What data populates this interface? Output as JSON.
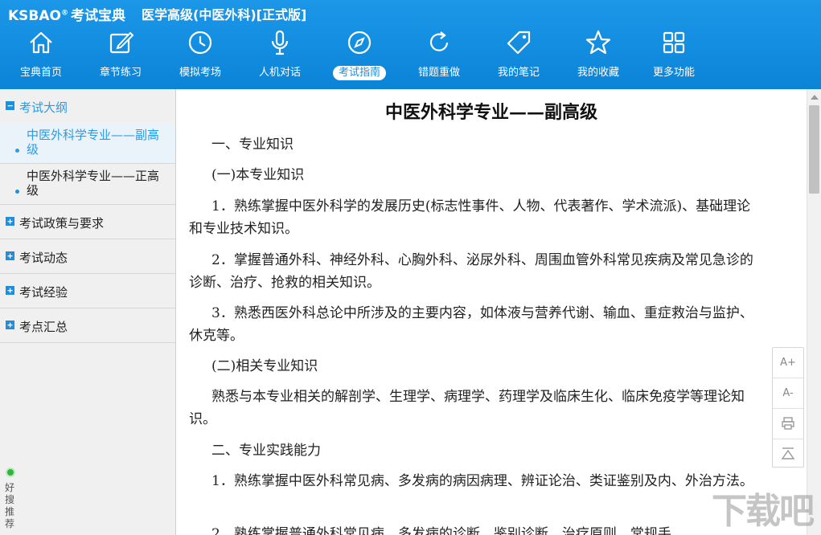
{
  "app": {
    "logo_text": "KSBAO",
    "logo_cn": "考试宝典",
    "title": "医学高级(中医外科)[正式版]"
  },
  "nav": [
    {
      "label": "宝典首页",
      "icon": "home-icon"
    },
    {
      "label": "章节练习",
      "icon": "edit-icon"
    },
    {
      "label": "模拟考场",
      "icon": "clock-icon"
    },
    {
      "label": "人机对话",
      "icon": "microphone-icon"
    },
    {
      "label": "考试指南",
      "icon": "compass-icon",
      "active": true
    },
    {
      "label": "错题重做",
      "icon": "refresh-icon"
    },
    {
      "label": "我的笔记",
      "icon": "tag-icon"
    },
    {
      "label": "我的收藏",
      "icon": "star-icon"
    },
    {
      "label": "更多功能",
      "icon": "grid-icon"
    }
  ],
  "sidebar": {
    "sections": [
      {
        "label": "考试大纲",
        "expanded": true,
        "items": [
          "中医外科学专业——副高级",
          "中医外科学专业——正高级"
        ]
      },
      {
        "label": "考试政策与要求"
      },
      {
        "label": "考试动态"
      },
      {
        "label": "考试经验"
      },
      {
        "label": "考点汇总"
      }
    ],
    "recommend": "好搜推荐"
  },
  "doc": {
    "title": "中医外科学专业——副高级",
    "paragraphs": [
      "一、专业知识",
      "(一)本专业知识",
      "1．熟练掌握中医外科学的发展历史(标志性事件、人物、代表著作、学术流派)、基础理论和专业技术知识。",
      "2．掌握普通外科、神经外科、心胸外科、泌尿外科、周围血管外科常见疾病及常见急诊的诊断、治疗、抢救的相关知识。",
      "3．熟悉西医外科总论中所涉及的主要内容，如体液与营养代谢、输血、重症救治与监护、休克等。",
      "(二)相关专业知识",
      "熟悉与本专业相关的解剖学、生理学、病理学、药理学及临床生化、临床免疫学等理论知识。",
      "二、专业实践能力",
      "1．熟练掌握中医外科常见病、多发病的病因病理、辨证论治、类证鉴别及内、外治方法。",
      "2．熟练掌握普通外科常见病、多发病的诊断、鉴别诊断、治疗原则、常规手"
    ]
  },
  "tools": {
    "font_increase": "A+",
    "font_decrease": "A-"
  },
  "watermark": "下载吧"
}
